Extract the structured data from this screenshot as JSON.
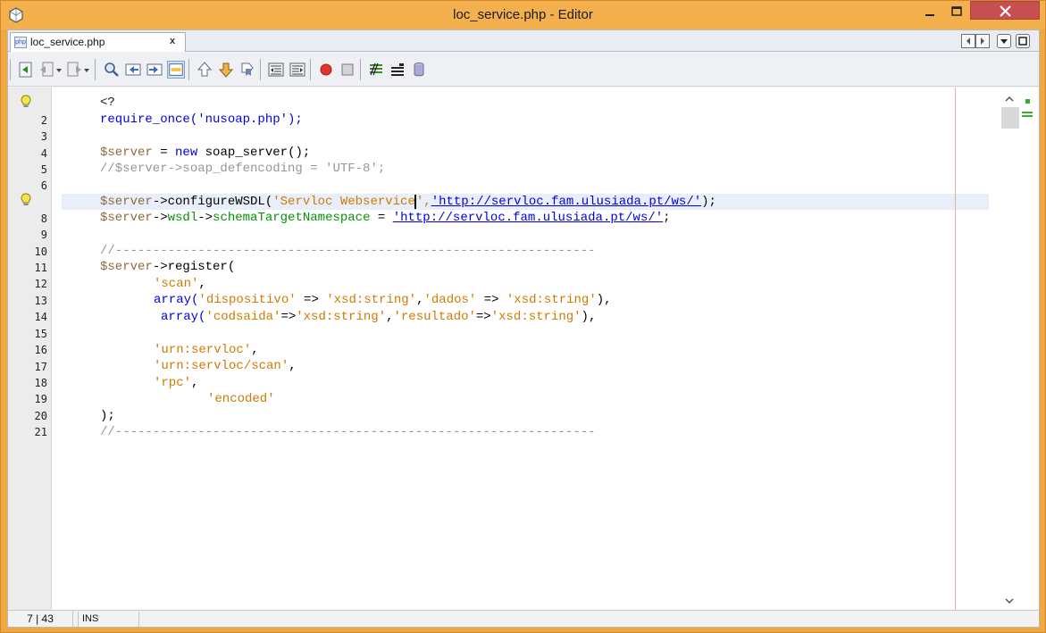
{
  "window": {
    "title": "loc_service.php - Editor",
    "close_label": "×"
  },
  "tab": {
    "icon_label": "php",
    "label": "loc_service.php",
    "close": "x"
  },
  "gutter": {
    "line_numbers": [
      "2",
      "3",
      "4",
      "5",
      "6",
      "8",
      "9",
      "10",
      "11",
      "12",
      "13",
      "14",
      "15",
      "16",
      "17",
      "18",
      "19",
      "20",
      "21"
    ]
  },
  "code_lines": {
    "l1": "<?",
    "l2": "require_once('nusoap.php');",
    "l4a": "$server",
    "l4b": " = ",
    "l4c": "new",
    "l4d": " soap_server();",
    "l5": "//$server->soap_defencoding = 'UTF-8';",
    "l7a": "$server",
    "l7b": "->configureWSDL(",
    "l7c": "'Servloc Webservice",
    "l7d": "',",
    "l7e": "'http://servloc.fam.ulusiada.pt/ws/'",
    "l7f": ");",
    "l8a": "$server",
    "l8b": "->",
    "l8c": "wsdl",
    "l8d": "->",
    "l8e": "schemaTargetNamespace",
    "l8f": " = ",
    "l8g": "'http://servloc.fam.ulusiada.pt/ws/'",
    "l8h": ";",
    "l10": "//----------------------------------------------------------------",
    "l11a": "$server",
    "l11b": "->register(",
    "l12": "'scan'",
    "l12b": ",",
    "l13a": "array(",
    "l13b": "'dispositivo'",
    "l13c": " => ",
    "l13d": "'xsd:string'",
    "l13e": ",",
    "l13f": "'dados'",
    "l13g": " => ",
    "l13h": "'xsd:string'",
    "l13i": "),",
    "l14a": "array(",
    "l14b": "'codsaida'",
    "l14c": "=>",
    "l14d": "'xsd:string'",
    "l14e": ",",
    "l14f": "'resultado'",
    "l14g": "=>",
    "l14h": "'xsd:string'",
    "l14i": "),",
    "l16": "'urn:servloc'",
    "l16b": ",",
    "l17": "'urn:servloc/scan'",
    "l17b": ",",
    "l18": "'rpc'",
    "l18b": ",",
    "l19": "'encoded'",
    "l20": ");",
    "l21": "//----------------------------------------------------------------"
  },
  "status": {
    "position": "7 | 43",
    "mode": "INS"
  },
  "colors": {
    "title_bar": "#f4b04c",
    "keyword": "#0000e6",
    "string": "#ce7b00",
    "comment": "#969696",
    "property": "#079307",
    "current_line": "#e9effa"
  }
}
